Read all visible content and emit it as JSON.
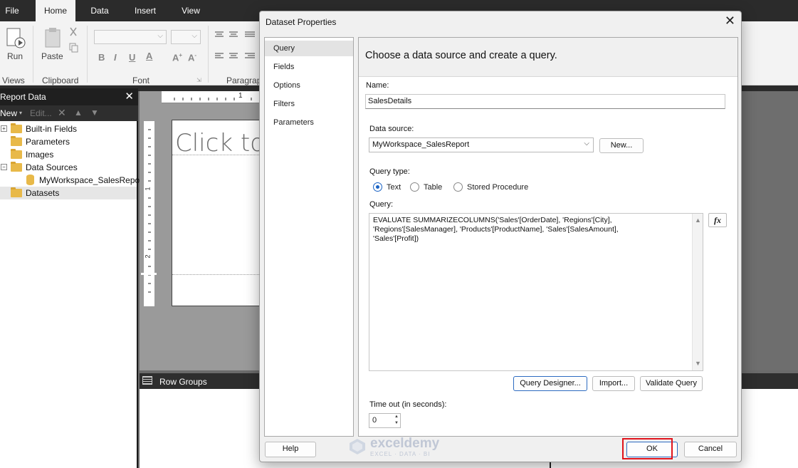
{
  "ribbon": {
    "tabs": [
      "File",
      "Home",
      "Data",
      "Insert",
      "View"
    ],
    "active_tab": "Home",
    "buttons": {
      "run": "Run",
      "paste": "Paste"
    },
    "groups": {
      "views": "Views",
      "clipboard": "Clipboard",
      "font": "Font",
      "paragraph": "Paragrap"
    }
  },
  "report_data": {
    "title": "Report Data",
    "toolbar": {
      "new": "New",
      "edit": "Edit..."
    },
    "tree": {
      "builtin": "Built-in Fields",
      "parameters": "Parameters",
      "images": "Images",
      "data_sources": "Data Sources",
      "workspace": "MyWorkspace_SalesReport",
      "datasets": "Datasets"
    }
  },
  "design": {
    "placeholder": "Click to",
    "ruler_mark": "1",
    "ruler_mark_left": "1",
    "ruler_mark_left2": "2"
  },
  "row_groups": {
    "label": "Row Groups"
  },
  "dialog": {
    "title": "Dataset Properties",
    "nav": [
      "Query",
      "Fields",
      "Options",
      "Filters",
      "Parameters"
    ],
    "selected_nav": "Query",
    "header": "Choose a data source and create a query.",
    "name_label": "Name:",
    "name_value": "SalesDetails",
    "data_source_label": "Data source:",
    "data_source_value": "MyWorkspace_SalesReport",
    "new_button": "New...",
    "query_type_label": "Query type:",
    "query_types": [
      "Text",
      "Table",
      "Stored Procedure"
    ],
    "selected_query_type": "Text",
    "query_label": "Query:",
    "query_text": "EVALUATE SUMMARIZECOLUMNS('Sales'[OrderDate], 'Regions'[City],\n'Regions'[SalesManager], 'Products'[ProductName], 'Sales'[SalesAmount],\n'Sales'[Profit])",
    "fx_button": "fx",
    "query_designer_button": "Query Designer...",
    "import_button": "Import...",
    "validate_button": "Validate Query",
    "timeout_label": "Time out (in seconds):",
    "timeout_value": "0",
    "help_button": "Help",
    "ok_button": "OK",
    "cancel_button": "Cancel"
  },
  "watermark": {
    "name": "exceldemy",
    "sub": "EXCEL · DATA · BI"
  },
  "colors": {
    "accent": "#1a63c4",
    "highlight": "#e0141c",
    "folder": "#e8b949"
  }
}
